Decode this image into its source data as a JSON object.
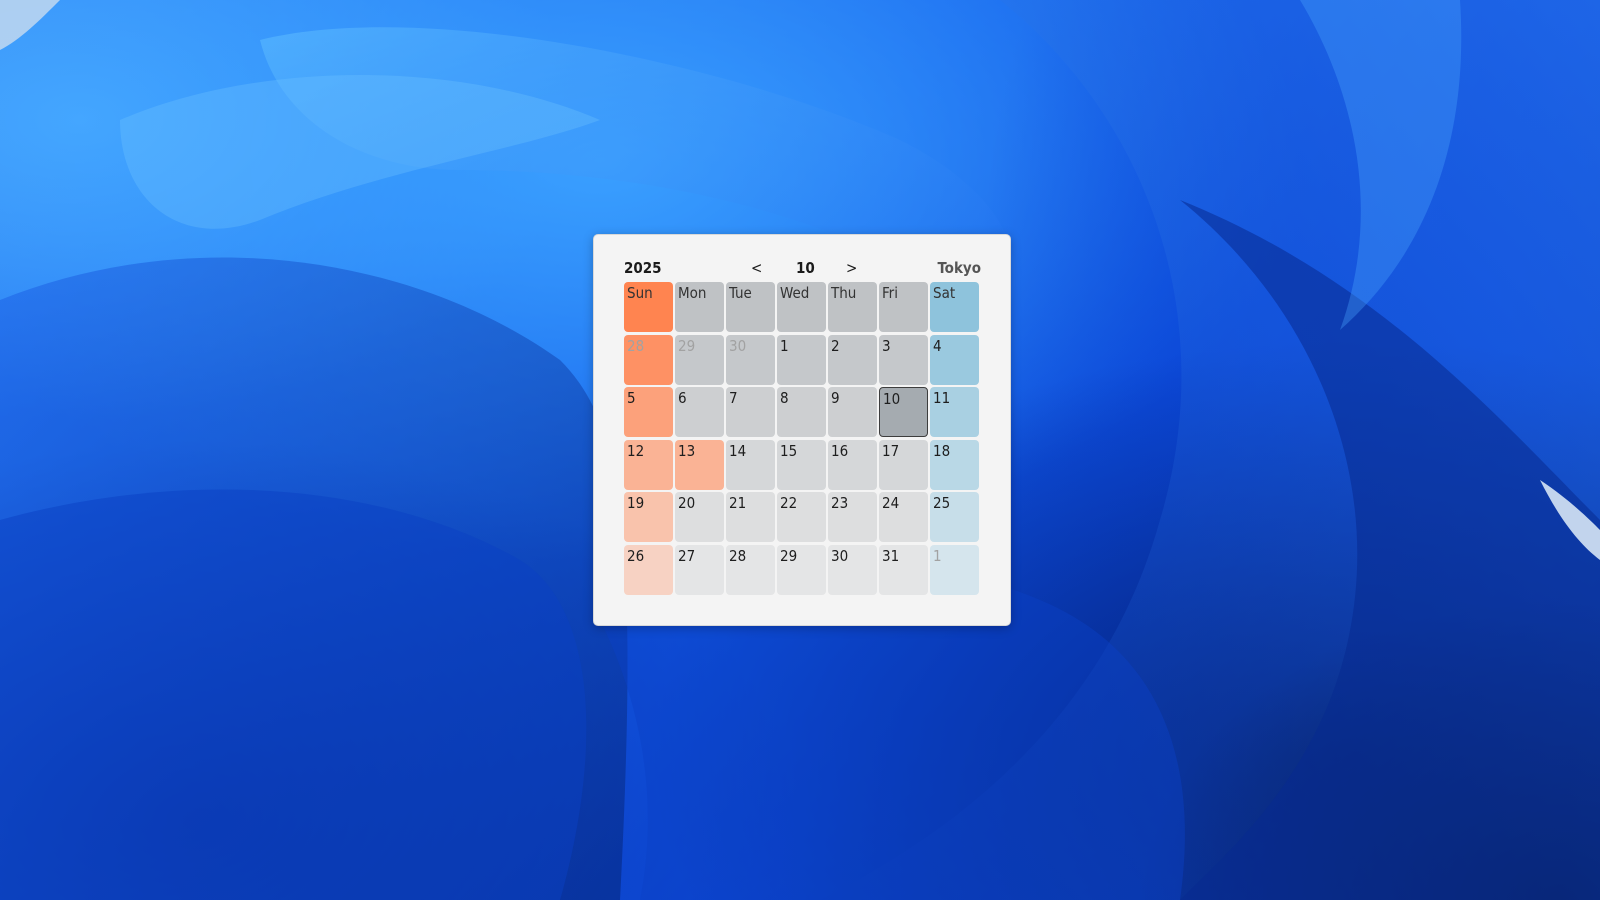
{
  "calendar": {
    "year": "2025",
    "prev": "<",
    "month": "10",
    "next": ">",
    "city": "Tokyo",
    "today": "10",
    "colors": {
      "sunday": "#ff8450",
      "saturday": "#8ec3dc",
      "weekday": "#bfc2c5"
    },
    "weekdays": [
      "Sun",
      "Mon",
      "Tue",
      "Wed",
      "Thu",
      "Fri",
      "Sat"
    ],
    "weeks": [
      [
        "28",
        "29",
        "30",
        "1",
        "2",
        "3",
        "4"
      ],
      [
        "5",
        "6",
        "7",
        "8",
        "9",
        "10",
        "11"
      ],
      [
        "12",
        "13",
        "14",
        "15",
        "16",
        "17",
        "18"
      ],
      [
        "19",
        "20",
        "21",
        "22",
        "23",
        "24",
        "25"
      ],
      [
        "26",
        "27",
        "28",
        "29",
        "30",
        "31",
        "1"
      ]
    ],
    "other_month": [
      [
        true,
        true,
        true,
        false,
        false,
        false,
        false
      ],
      [
        false,
        false,
        false,
        false,
        false,
        false,
        false
      ],
      [
        false,
        false,
        false,
        false,
        false,
        false,
        false
      ],
      [
        false,
        false,
        false,
        false,
        false,
        false,
        false
      ],
      [
        false,
        false,
        false,
        false,
        false,
        false,
        true
      ]
    ],
    "holidays": [
      "13"
    ]
  }
}
